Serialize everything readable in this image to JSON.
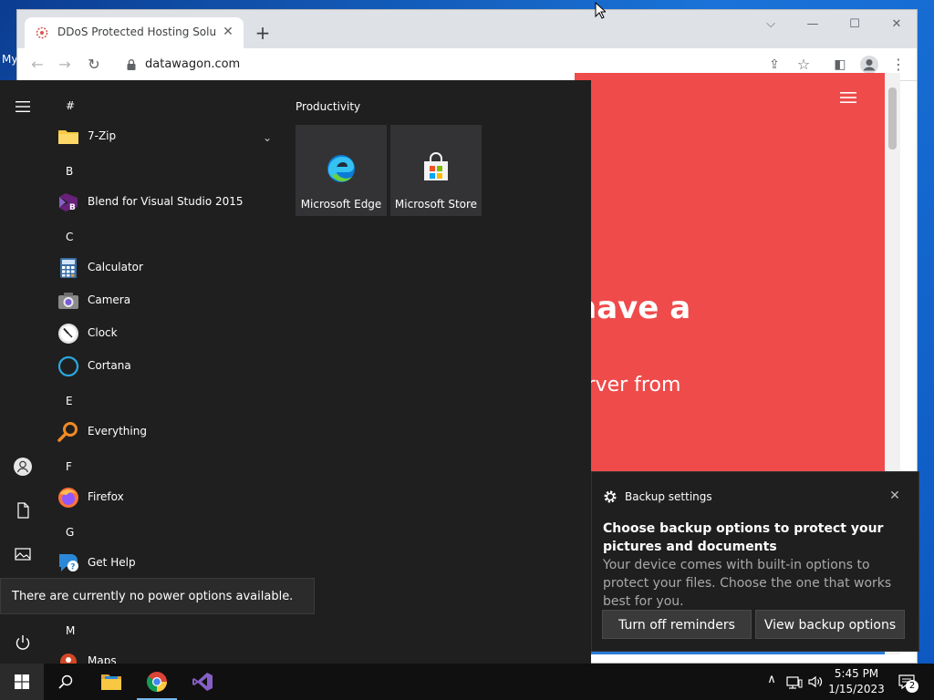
{
  "desktop": {
    "label": "My"
  },
  "browser": {
    "tab_title": "DDoS Protected Hosting Solutions",
    "url": "datawagon.com",
    "page": {
      "hero_line1": "have a",
      "hero_line2": "erver from"
    }
  },
  "start_menu": {
    "sections": [
      {
        "letter": "#",
        "apps": [
          {
            "name": "7-Zip",
            "icon": "folder-icon"
          }
        ]
      },
      {
        "letter": "B",
        "apps": [
          {
            "name": "Blend for Visual Studio 2015",
            "icon": "blend-icon"
          }
        ]
      },
      {
        "letter": "C",
        "apps": [
          {
            "name": "Calculator",
            "icon": "calculator-icon"
          },
          {
            "name": "Camera",
            "icon": "camera-icon"
          },
          {
            "name": "Clock",
            "icon": "clock-icon"
          },
          {
            "name": "Cortana",
            "icon": "cortana-icon"
          }
        ]
      },
      {
        "letter": "E",
        "apps": [
          {
            "name": "Everything",
            "icon": "search-icon"
          }
        ]
      },
      {
        "letter": "F",
        "apps": [
          {
            "name": "Firefox",
            "icon": "firefox-icon"
          }
        ]
      },
      {
        "letter": "G",
        "apps": [
          {
            "name": "Get Help",
            "icon": "help-icon"
          }
        ]
      },
      {
        "letter": "M",
        "apps": [
          {
            "name": "Maps",
            "icon": "maps-icon"
          }
        ]
      }
    ],
    "group_title": "Productivity",
    "tiles": [
      {
        "label": "Microsoft Edge",
        "icon": "edge-icon"
      },
      {
        "label": "Microsoft Store",
        "icon": "store-icon"
      }
    ],
    "power_tooltip": "There are currently no power options available."
  },
  "toast": {
    "app_name": "Backup settings",
    "heading": "Choose backup options to protect your pictures and documents",
    "body": "Your device comes with built-in options to protect your files. Choose the one that works best for you.",
    "button_secondary": "Turn off reminders",
    "button_primary": "View backup options"
  },
  "taskbar": {
    "time": "5:45 PM",
    "date": "1/15/2023",
    "notification_count": "2"
  },
  "colors": {
    "page_accent": "#ef4b4b",
    "start_menu_bg": "#1f1f1f",
    "taskbar_bg": "#101010"
  }
}
